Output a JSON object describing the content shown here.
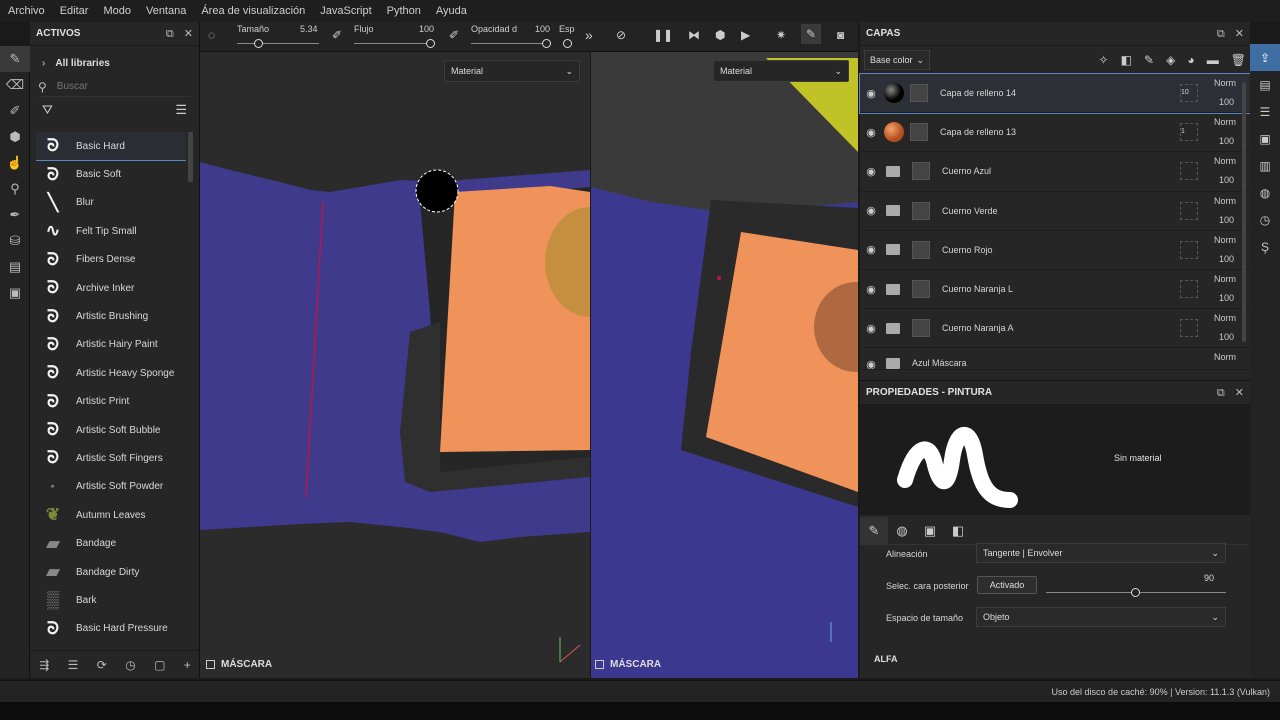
{
  "menu": [
    "Archivo",
    "Editar",
    "Modo",
    "Ventana",
    "Área de visualización",
    "JavaScript",
    "Python",
    "Ayuda"
  ],
  "toolbar": {
    "size_label": "Tamaño",
    "size_value": "5.34",
    "flow_label": "Flujo",
    "flow_value": "100",
    "opacity_label": "Opacidad d",
    "opacity_value": "100",
    "spacing_label": "Esp"
  },
  "assets": {
    "title": "ACTIVOS",
    "library": "All libraries",
    "search_placeholder": "Buscar",
    "brushes": [
      "Basic Hard",
      "Basic Soft",
      "Blur",
      "Felt Tip Small",
      "Fibers Dense",
      "Archive Inker",
      "Artistic Brushing",
      "Artistic Hairy Paint",
      "Artistic Heavy Sponge",
      "Artistic Print",
      "Artistic Soft Bubble",
      "Artistic Soft Fingers",
      "Artistic Soft Powder",
      "Autumn Leaves",
      "Bandage",
      "Bandage Dirty",
      "Bark",
      "Basic Hard Pressure"
    ]
  },
  "viewport_left": {
    "select_value": "Material",
    "mask_label": "MÁSCARA"
  },
  "viewport_right": {
    "select_value": "Material",
    "mask_label": "MÁSCARA"
  },
  "layers": {
    "title": "CAPAS",
    "blend_select": "Base color",
    "items": [
      {
        "name": "Capa de relleno 14",
        "blend": "Norm",
        "opacity": "100",
        "mask_value": "10"
      },
      {
        "name": "Capa de relleno 13",
        "blend": "Norm",
        "opacity": "100",
        "mask_value": "1"
      },
      {
        "name": "Cuerno Azul",
        "blend": "Norm",
        "opacity": "100"
      },
      {
        "name": "Cuerno Verde",
        "blend": "Norm",
        "opacity": "100"
      },
      {
        "name": "Cuerno Rojo",
        "blend": "Norm",
        "opacity": "100"
      },
      {
        "name": "Cuerno Naranja L",
        "blend": "Norm",
        "opacity": "100"
      },
      {
        "name": "Cuerno Naranja A",
        "blend": "Norm",
        "opacity": "100"
      },
      {
        "name": "Azul Máscara",
        "blend": "Norm",
        "opacity": ""
      }
    ]
  },
  "properties": {
    "title": "PROPIEDADES - PINTURA",
    "material_text": "Sin material",
    "alignment_label": "Alineación",
    "alignment_value": "Tangente | Envolver",
    "backface_label": "Selec. cara posterior",
    "backface_button": "Activado",
    "backface_angle": "90",
    "size_space_label": "Espacio de tamaño",
    "size_space_value": "Objeto",
    "alpha_section": "ALFA"
  },
  "status": {
    "text": "Uso del disco de caché:  90% | Version: 11.1.3 (Vulkan)"
  }
}
